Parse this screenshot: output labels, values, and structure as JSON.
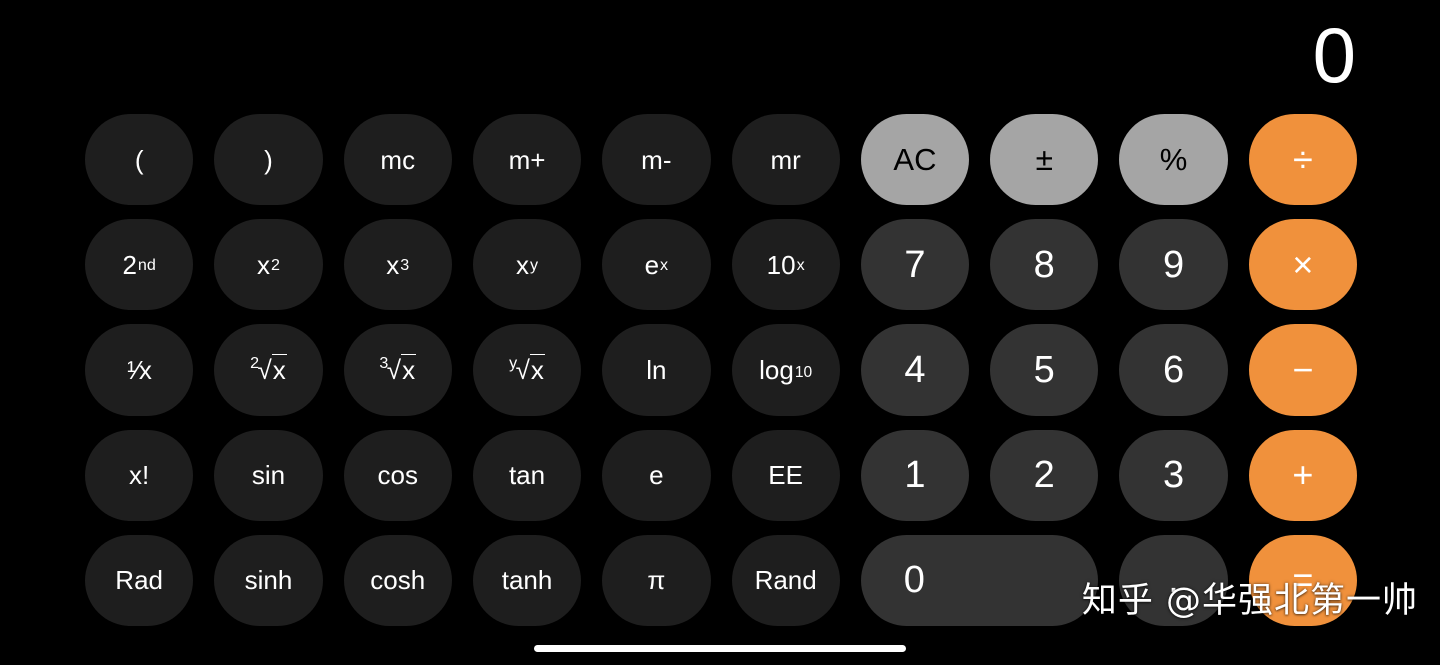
{
  "app": {
    "name": "Calculator",
    "mode": "scientific-landscape",
    "theme": "dark"
  },
  "colors": {
    "background": "#000000",
    "function_key": "#1e1e1e",
    "number_key": "#333333",
    "utility_key": "#a5a5a5",
    "operator_key": "#f0913c",
    "text_light": "#ffffff",
    "text_dark": "#000000"
  },
  "display": {
    "value": "0"
  },
  "keypad": {
    "rows": [
      [
        {
          "label": "(",
          "name": "open-paren-key",
          "type": "fn"
        },
        {
          "label": ")",
          "name": "close-paren-key",
          "type": "fn"
        },
        {
          "label": "mc",
          "name": "memory-clear-key",
          "type": "fn"
        },
        {
          "label": "m+",
          "name": "memory-add-key",
          "type": "fn"
        },
        {
          "label": "m-",
          "name": "memory-subtract-key",
          "type": "fn"
        },
        {
          "label": "mr",
          "name": "memory-recall-key",
          "type": "fn"
        },
        {
          "label": "AC",
          "name": "all-clear-key",
          "type": "util"
        },
        {
          "label": "+/-",
          "name": "sign-toggle-key",
          "type": "util"
        },
        {
          "label": "%",
          "name": "percent-key",
          "type": "util"
        },
        {
          "label": "÷",
          "name": "divide-key",
          "type": "op"
        }
      ],
      [
        {
          "label": "2nd",
          "name": "second-function-key",
          "type": "fn"
        },
        {
          "label": "x²",
          "name": "x-squared-key",
          "type": "fn"
        },
        {
          "label": "x³",
          "name": "x-cubed-key",
          "type": "fn"
        },
        {
          "label": "xʸ",
          "name": "x-power-y-key",
          "type": "fn"
        },
        {
          "label": "eˣ",
          "name": "e-power-x-key",
          "type": "fn"
        },
        {
          "label": "10ˣ",
          "name": "ten-power-x-key",
          "type": "fn"
        },
        {
          "label": "7",
          "name": "digit-7-key",
          "type": "num"
        },
        {
          "label": "8",
          "name": "digit-8-key",
          "type": "num"
        },
        {
          "label": "9",
          "name": "digit-9-key",
          "type": "num"
        },
        {
          "label": "×",
          "name": "multiply-key",
          "type": "op"
        }
      ],
      [
        {
          "label": "1/x",
          "name": "reciprocal-key",
          "type": "fn"
        },
        {
          "label": "²√x",
          "name": "square-root-key",
          "type": "fn"
        },
        {
          "label": "³√x",
          "name": "cube-root-key",
          "type": "fn"
        },
        {
          "label": "ʸ√x",
          "name": "nth-root-key",
          "type": "fn"
        },
        {
          "label": "ln",
          "name": "natural-log-key",
          "type": "fn"
        },
        {
          "label": "log10",
          "name": "log-base-10-key",
          "type": "fn"
        },
        {
          "label": "4",
          "name": "digit-4-key",
          "type": "num"
        },
        {
          "label": "5",
          "name": "digit-5-key",
          "type": "num"
        },
        {
          "label": "6",
          "name": "digit-6-key",
          "type": "num"
        },
        {
          "label": "−",
          "name": "subtract-key",
          "type": "op"
        }
      ],
      [
        {
          "label": "x!",
          "name": "factorial-key",
          "type": "fn"
        },
        {
          "label": "sin",
          "name": "sine-key",
          "type": "fn"
        },
        {
          "label": "cos",
          "name": "cosine-key",
          "type": "fn"
        },
        {
          "label": "tan",
          "name": "tangent-key",
          "type": "fn"
        },
        {
          "label": "e",
          "name": "euler-e-key",
          "type": "fn"
        },
        {
          "label": "EE",
          "name": "exponent-key",
          "type": "fn"
        },
        {
          "label": "1",
          "name": "digit-1-key",
          "type": "num"
        },
        {
          "label": "2",
          "name": "digit-2-key",
          "type": "num"
        },
        {
          "label": "3",
          "name": "digit-3-key",
          "type": "num"
        },
        {
          "label": "+",
          "name": "add-key",
          "type": "op"
        }
      ],
      [
        {
          "label": "Rad",
          "name": "radian-mode-key",
          "type": "fn"
        },
        {
          "label": "sinh",
          "name": "hyperbolic-sine-key",
          "type": "fn"
        },
        {
          "label": "cosh",
          "name": "hyperbolic-cosine-key",
          "type": "fn"
        },
        {
          "label": "tanh",
          "name": "hyperbolic-tangent-key",
          "type": "fn"
        },
        {
          "label": "π",
          "name": "pi-key",
          "type": "fn"
        },
        {
          "label": "Rand",
          "name": "random-key",
          "type": "fn"
        },
        {
          "label": "0",
          "name": "digit-0-key",
          "type": "num",
          "span": 2
        },
        {
          "label": ".",
          "name": "decimal-point-key",
          "type": "num"
        },
        {
          "label": "=",
          "name": "equals-key",
          "type": "op"
        }
      ]
    ]
  },
  "watermark": {
    "text": "知乎 @华强北第一帅"
  }
}
